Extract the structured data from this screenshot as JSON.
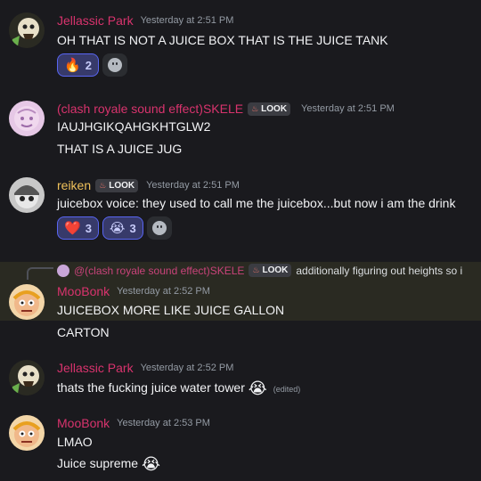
{
  "colors": {
    "jellassic": "#d8336d",
    "skele": "#d8336d",
    "reiken": "#f0c15a",
    "moobonk": "#d8336d"
  },
  "messages": [
    {
      "author": "Jellassic Park",
      "timestamp": "Yesterday at 2:51 PM",
      "lines": [
        "OH THAT IS NOT A JUICE BOX THAT IS THE JUICE TANK"
      ],
      "reactions": [
        {
          "emoji": "🔥",
          "count": "2"
        }
      ]
    },
    {
      "author": "(clash royale sound effect)SKELE",
      "tag": "LOOK",
      "timestamp": "Yesterday at 2:51 PM",
      "lines": [
        "IAUJHGIKQAHGKHTGLW2",
        "THAT IS A JUICE JUG"
      ]
    },
    {
      "author": "reiken",
      "tag": "LOOK",
      "timestamp": "Yesterday at 2:51 PM",
      "lines": [
        "juicebox voice: they used to call me the juicebox...but now i am the drink"
      ],
      "reactions": [
        {
          "emoji": "❤️",
          "count": "3"
        },
        {
          "emoji": "😭",
          "count": "3"
        }
      ]
    },
    {
      "reply": {
        "author": "@(clash royale sound effect)SKELE",
        "tag": "LOOK",
        "text": "additionally figuring out heights so i"
      },
      "author": "MooBonk",
      "timestamp": "Yesterday at 2:52 PM",
      "lines": [
        "JUICEBOX MORE LIKE JUICE GALLON",
        "CARTON"
      ]
    },
    {
      "author": "Jellassic Park",
      "timestamp": "Yesterday at 2:52 PM",
      "lines": [
        "thats the fucking juice water tower"
      ],
      "line_emoji": "😭",
      "edited": "(edited)"
    },
    {
      "author": "MooBonk",
      "timestamp": "Yesterday at 2:53 PM",
      "lines": [
        "LMAO",
        "Juice supreme"
      ],
      "line_emoji": "😭"
    }
  ]
}
